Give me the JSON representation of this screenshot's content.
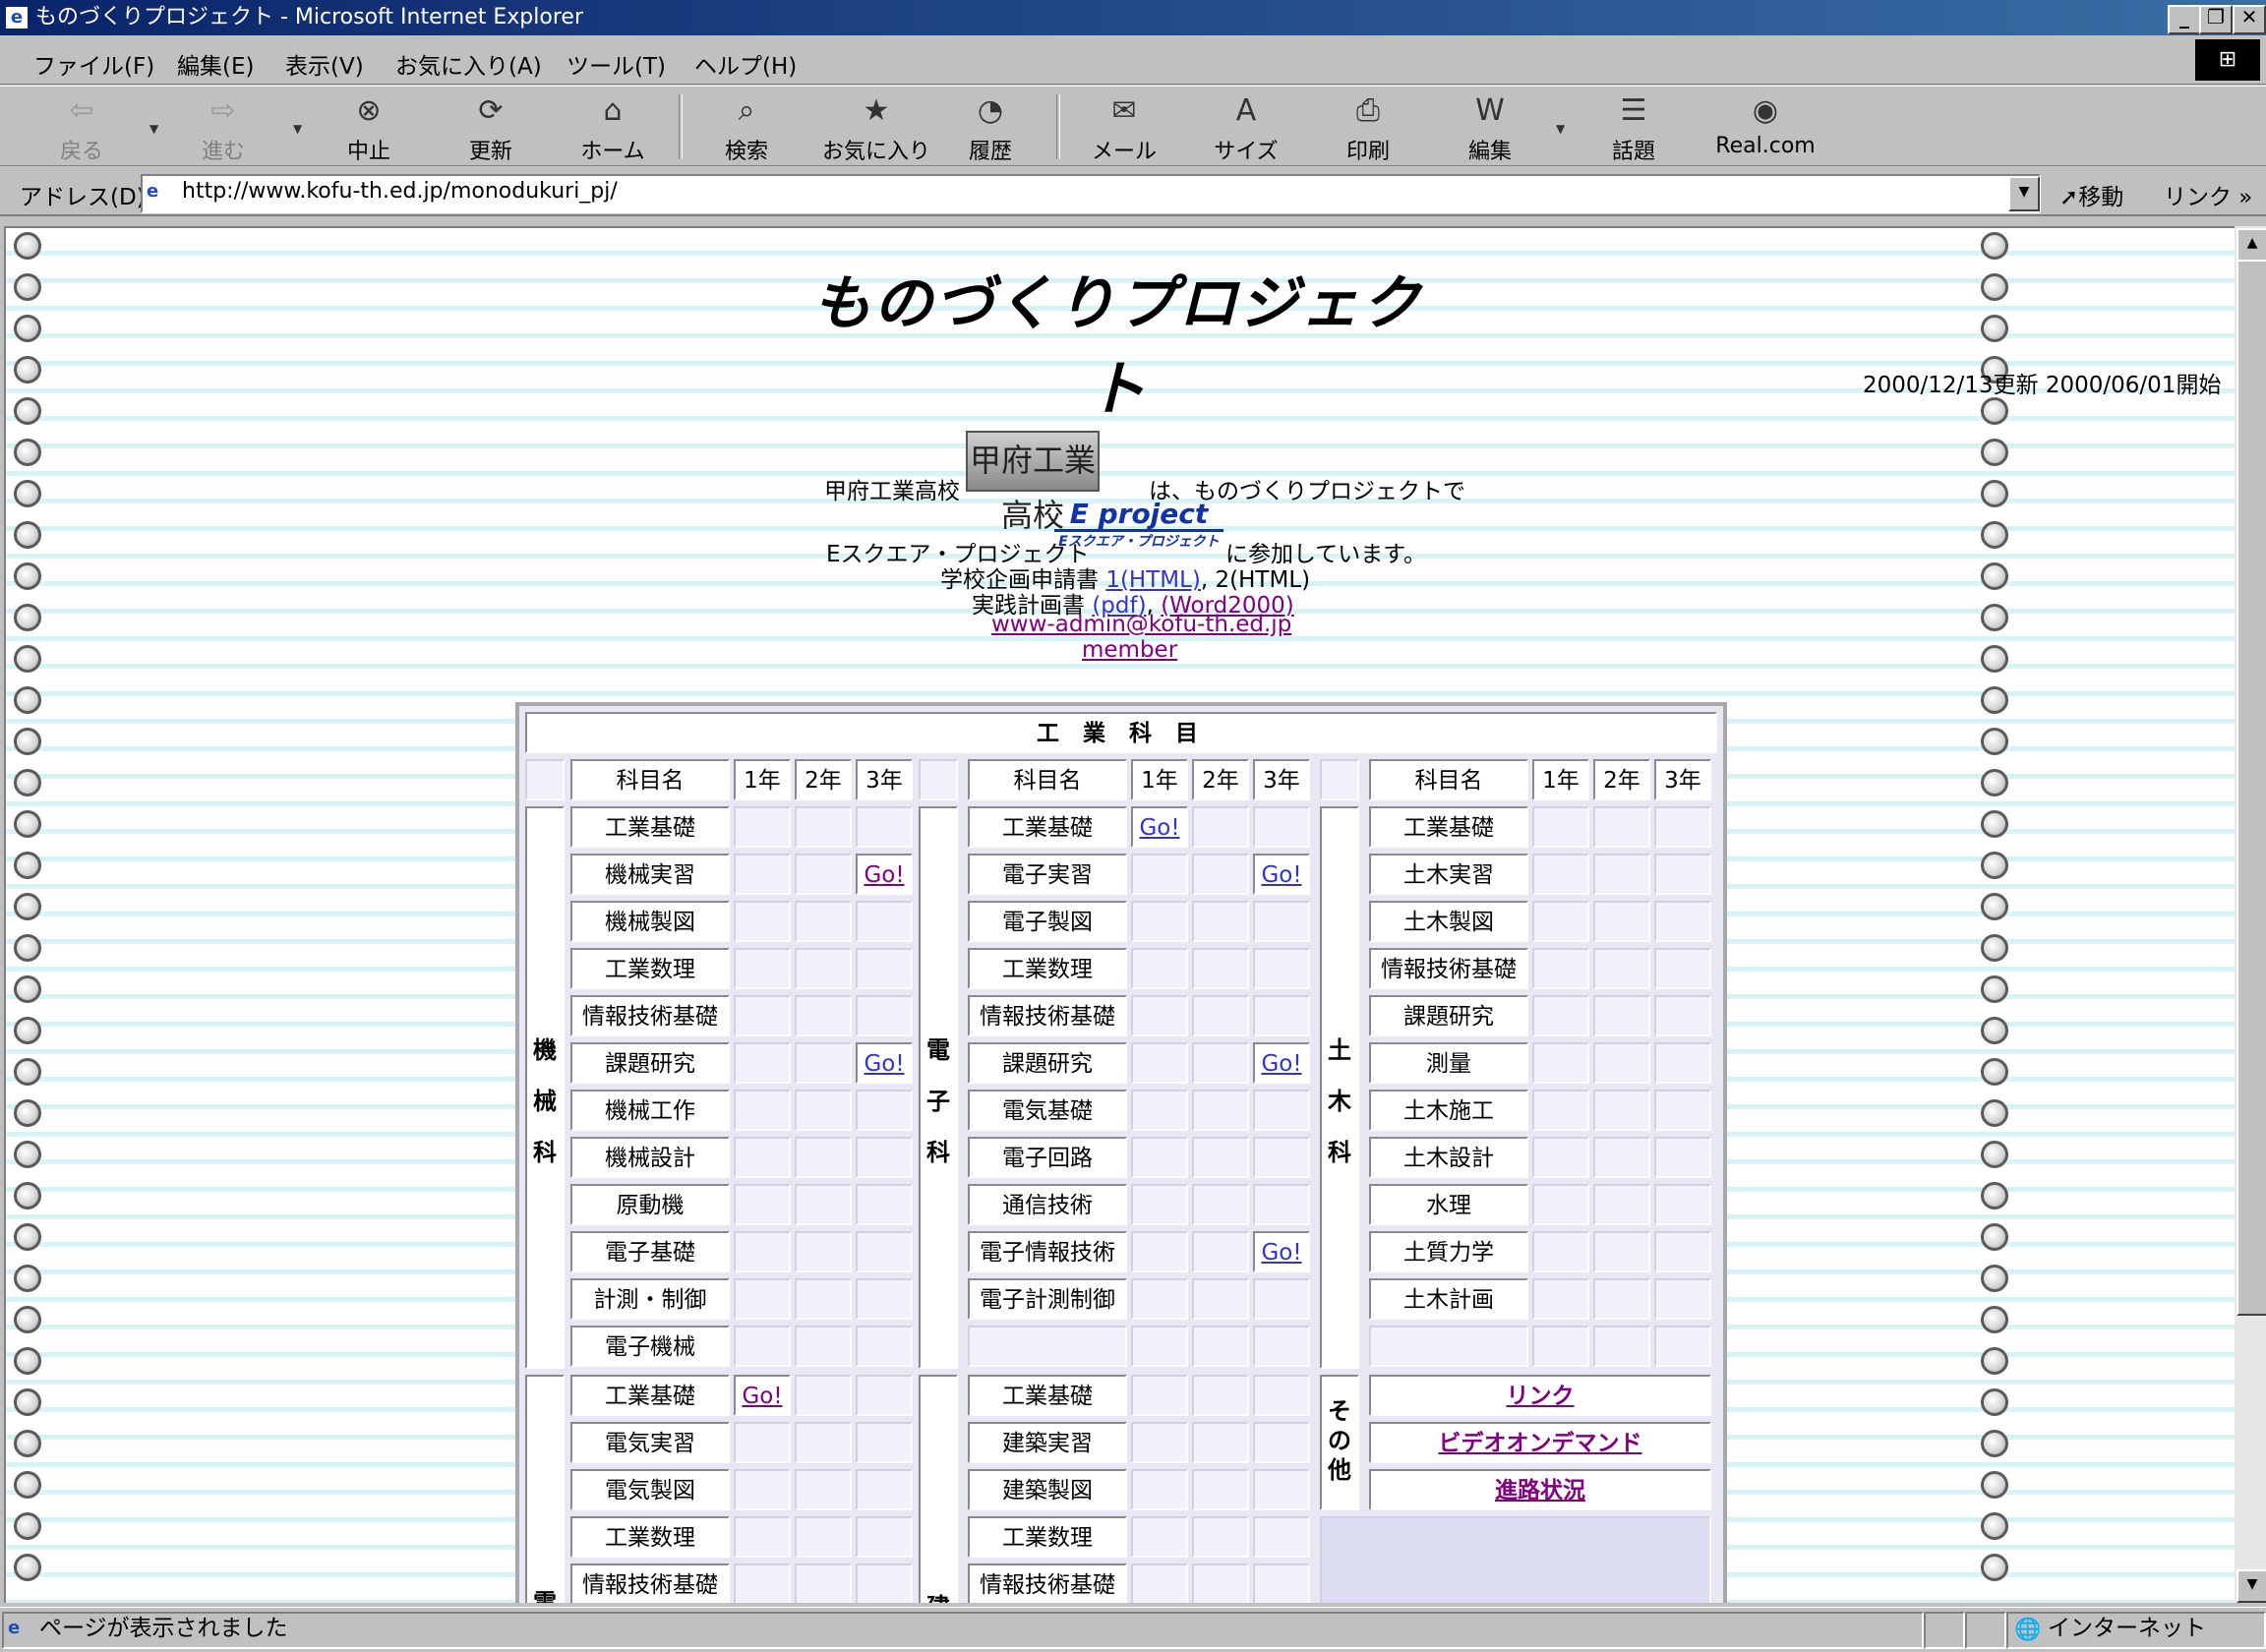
{
  "window": {
    "title": "ものづくりプロジェクト - Microsoft Internet Explorer"
  },
  "menu": [
    "ファイル(F)",
    "編集(E)",
    "表示(V)",
    "お気に入り(A)",
    "ツール(T)",
    "ヘルプ(H)"
  ],
  "toolbar": {
    "back": "戻る",
    "forward": "進む",
    "stop": "中止",
    "refresh": "更新",
    "home": "ホーム",
    "search": "検索",
    "favorites": "お気に入り",
    "history": "履歴",
    "mail": "メール",
    "size": "サイズ",
    "print": "印刷",
    "edit": "編集",
    "discuss": "話題",
    "real": "Real.com"
  },
  "address": {
    "label": "アドレス(D)",
    "url": "http://www.kofu-th.ed.jp/monodukuri_pj/",
    "go": "移動",
    "links": "リンク"
  },
  "page": {
    "title": "ものづくりプロジェクト",
    "update": "2000/12/13更新 2000/06/01開始",
    "school_logo": "甲府工業高校",
    "line1_pre": "甲府工業高校",
    "line1_post": "は、ものづくりプロジェクトで",
    "line2_pre": "Eスクエア・プロジェクト",
    "line2_post": "に参加しています。",
    "eproject_top": "E project",
    "eproject_bottom": "Eスクエア・プロジェクト",
    "plan_label": "学校企画申請書",
    "plan_link1": "1(HTML)",
    "plan_sep": ",",
    "plan_text2": "2(HTML)",
    "practice_label": "実践計画書",
    "practice_pdf": "(pdf)",
    "practice_word": "(Word2000)",
    "email": "www-admin@kofu-th.ed.jp",
    "member": "member"
  },
  "table": {
    "header": "工 業 科 目",
    "col_name": "科目名",
    "years": [
      "1年",
      "2年",
      "3年"
    ],
    "go": "Go!",
    "dept_kikai": "機械科",
    "dept_denshi": "電子科",
    "dept_doboku": "土木科",
    "dept_sonota": "その他",
    "dept_denki": "電",
    "dept_kenchiku": "建",
    "kikai": [
      "工業基礎",
      "機械実習",
      "機械製図",
      "工業数理",
      "情報技術基礎",
      "課題研究",
      "機械工作",
      "機械設計",
      "原動機",
      "電子基礎",
      "計測・制御",
      "電子機械"
    ],
    "denshi": [
      "工業基礎",
      "電子実習",
      "電子製図",
      "工業数理",
      "情報技術基礎",
      "課題研究",
      "電気基礎",
      "電子回路",
      "通信技術",
      "電子情報技術",
      "電子計測制御"
    ],
    "doboku": [
      "工業基礎",
      "土木実習",
      "土木製図",
      "情報技術基礎",
      "課題研究",
      "測量",
      "土木施工",
      "土木設計",
      "水理",
      "土質力学",
      "土木計画"
    ],
    "denki": [
      "工業基礎",
      "電気実習",
      "電気製図",
      "工業数理",
      "情報技術基礎"
    ],
    "kenchiku": [
      "工業基礎",
      "建築実習",
      "建築製図",
      "工業数理",
      "情報技術基礎"
    ],
    "other_links": [
      "リンク",
      "ビデオオンデマンド",
      "進路状況"
    ]
  },
  "status": {
    "text": "ページが表示されました",
    "zone": "インターネット"
  }
}
